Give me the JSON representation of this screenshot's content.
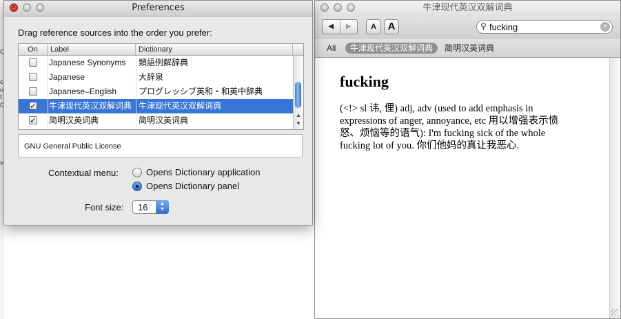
{
  "background_window": {
    "fragments": [
      "C",
      "c",
      "n",
      "f",
      "C",
      "v"
    ]
  },
  "preferences": {
    "title": "Preferences",
    "instruction": "Drag reference sources into the order you prefer:",
    "columns": {
      "on": "On",
      "label": "Label",
      "dictionary": "Dictionary"
    },
    "rows": [
      {
        "checked": false,
        "label": "Japanese Synonyms",
        "dictionary": "類語例解辞典",
        "selected": false
      },
      {
        "checked": false,
        "label": "Japanese",
        "dictionary": "大辞泉",
        "selected": false
      },
      {
        "checked": false,
        "label": "Japanese–English",
        "dictionary": "プログレッシブ英和・和英中辞典",
        "selected": false
      },
      {
        "checked": true,
        "label": "牛津现代英汉双解词典",
        "dictionary": "牛津现代英汉双解词典",
        "selected": true
      },
      {
        "checked": true,
        "label": "简明汉英词典",
        "dictionary": "简明汉英词典",
        "selected": false
      }
    ],
    "license": "GNU General Public License",
    "contextual_menu_label": "Contextual menu:",
    "contextual_options": [
      {
        "label": "Opens Dictionary application",
        "selected": false
      },
      {
        "label": "Opens Dictionary panel",
        "selected": true
      }
    ],
    "font_size_label": "Font size:",
    "font_size_value": "16",
    "accent_color": "#3875d7"
  },
  "dictionary": {
    "title": "牛津现代英汉双解词典",
    "nav": {
      "back": "◀",
      "forward": "▶"
    },
    "font_smaller": "A",
    "font_larger": "A",
    "search_value": "fucking",
    "scopes": [
      {
        "label": "All",
        "active": false
      },
      {
        "label": "牛津现代英汉双解词典",
        "active": true
      },
      {
        "label": "简明汉英词典",
        "active": false
      }
    ],
    "headword": "fucking",
    "definition": "(<!> sl 讳, 俚) adj, adv (used to add emphasis in expressions of anger, annoyance, etc 用以增强表示愤怒、烦恼等的语气): I'm fucking sick of the whole fucking lot of you. 你们他妈的真让我恶心."
  }
}
